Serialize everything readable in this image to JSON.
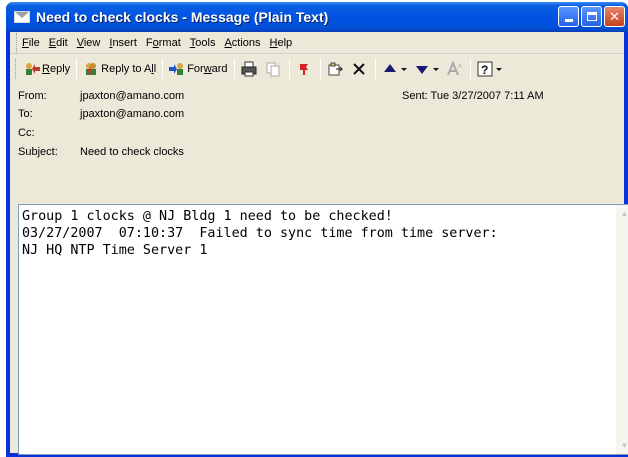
{
  "window": {
    "title": "Need to check clocks - Message (Plain Text)"
  },
  "menu": {
    "items": [
      {
        "u": "F",
        "rest": "ile"
      },
      {
        "u": "E",
        "rest": "dit"
      },
      {
        "u": "V",
        "rest": "iew"
      },
      {
        "u": "I",
        "rest": "nsert"
      },
      {
        "pre": "F",
        "u": "o",
        "rest": "rmat"
      },
      {
        "u": "T",
        "rest": "ools"
      },
      {
        "u": "A",
        "rest": "ctions"
      },
      {
        "u": "H",
        "rest": "elp"
      }
    ]
  },
  "toolbar": {
    "reply_pre": "",
    "reply_u": "R",
    "reply_rest": "eply",
    "reply_all_pre": "Reply to A",
    "reply_all_u": "l",
    "reply_all_rest": "l",
    "forward_pre": "For",
    "forward_u": "w",
    "forward_rest": "ard"
  },
  "header": {
    "from_label": "From:",
    "from_value": "jpaxton@amano.com",
    "to_label": "To:",
    "to_value": "jpaxton@amano.com",
    "cc_label": "Cc:",
    "cc_value": "",
    "subject_label": "Subject:",
    "subject_value": "Need to check clocks",
    "sent_label": "Sent:",
    "sent_value": "Tue 3/27/2007 7:11 AM"
  },
  "body": {
    "lines": [
      "Group 1 clocks @ NJ Bldg 1 need to be checked!",
      "03/27/2007  07:10:37  Failed to sync time from time server:",
      "NJ HQ NTP Time Server 1"
    ]
  },
  "colors": {
    "title_bar": "#0054e3",
    "window_border": "#0831d9",
    "close_button": "#c4431f",
    "chrome": "#ece9d8"
  }
}
